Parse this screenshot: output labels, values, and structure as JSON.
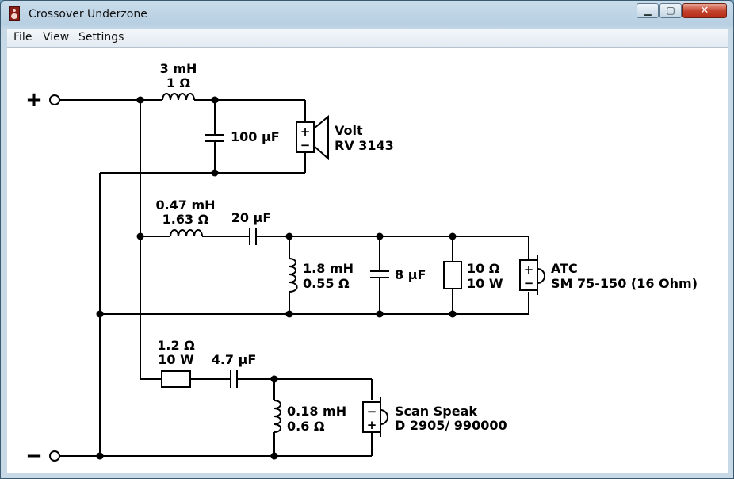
{
  "window": {
    "title": "Crossover Underzone",
    "icon": "speaker-icon"
  },
  "title_controls": {
    "minimize": "minimize-icon",
    "maximize": "maximize-icon",
    "close": "close-icon"
  },
  "menu": {
    "items": [
      "File",
      "View",
      "Settings"
    ]
  },
  "schematic": {
    "terminals": {
      "positive": "+",
      "negative": "−"
    },
    "tweeter_section": {
      "inductor": {
        "value": "3 mH",
        "resistance": "1 Ω"
      },
      "capacitor": "100 μF",
      "driver": {
        "brand": "Volt",
        "model": "RV 3143"
      }
    },
    "mid_section": {
      "inductor": {
        "value": "0.47 mH",
        "resistance": "1.63 Ω"
      },
      "series_capacitor": "20 μF",
      "shunt_inductor": {
        "value": "1.8 mH",
        "resistance": "0.55 Ω"
      },
      "shunt_capacitor": "8 μF",
      "resistor": {
        "value": "10 Ω",
        "power": "10 W"
      },
      "driver": {
        "brand": "ATC",
        "model": "SM 75-150 (16 Ohm)"
      }
    },
    "woofer_section": {
      "resistor": {
        "value": "1.2 Ω",
        "power": "10 W"
      },
      "capacitor": "4.7 μF",
      "shunt_inductor": {
        "value": "0.18 mH",
        "resistance": "0.6 Ω"
      },
      "driver": {
        "brand": "Scan Speak",
        "model": "D 2905/ 990000"
      }
    }
  },
  "colors": {
    "title_bar": "#b7cfe2",
    "close_button": "#c4452f",
    "schematic_ink": "#000000",
    "canvas": "#ffffff"
  }
}
